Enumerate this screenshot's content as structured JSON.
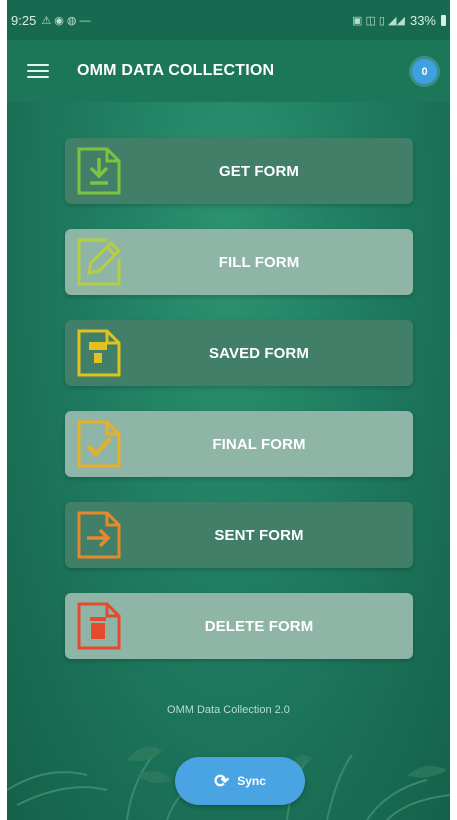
{
  "statusbar": {
    "time": "9:25",
    "battery": "33%"
  },
  "appbar": {
    "title": "OMM DATA COLLECTION",
    "badge_count": "0"
  },
  "menu": {
    "items": [
      {
        "label": "GET FORM",
        "icon": "download-file-icon",
        "color": "#7fc241"
      },
      {
        "label": "FILL FORM",
        "icon": "edit-file-icon",
        "color": "#b6cf42"
      },
      {
        "label": "SAVED FORM",
        "icon": "save-file-icon",
        "color": "#e3c21f"
      },
      {
        "label": "FINAL FORM",
        "icon": "check-file-icon",
        "color": "#e8b026"
      },
      {
        "label": "SENT FORM",
        "icon": "send-file-icon",
        "color": "#e5892a"
      },
      {
        "label": "DELETE FORM",
        "icon": "delete-file-icon",
        "color": "#e44a2d"
      }
    ]
  },
  "footer": {
    "version_text": "OMM Data Collection 2.0"
  },
  "sync": {
    "label": "Sync"
  }
}
